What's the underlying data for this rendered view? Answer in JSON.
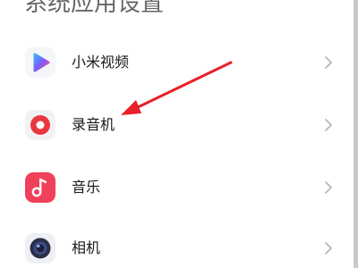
{
  "page": {
    "title": "系统应用设置"
  },
  "apps": [
    {
      "label": "小米视频",
      "icon": "mi-video-icon"
    },
    {
      "label": "录音机",
      "icon": "recorder-icon"
    },
    {
      "label": "音乐",
      "icon": "music-icon"
    },
    {
      "label": "相机",
      "icon": "camera-icon"
    }
  ],
  "colors": {
    "title_text": "#666666",
    "item_text": "#1a1a1a",
    "chevron": "#b3b3b3",
    "annotation_arrow": "#e8202a",
    "recorder_icon": "#e8383d",
    "music_icon": "#f0405a",
    "camera_icon": "#2a2f45"
  },
  "annotation": {
    "arrow_target": "录音机"
  }
}
